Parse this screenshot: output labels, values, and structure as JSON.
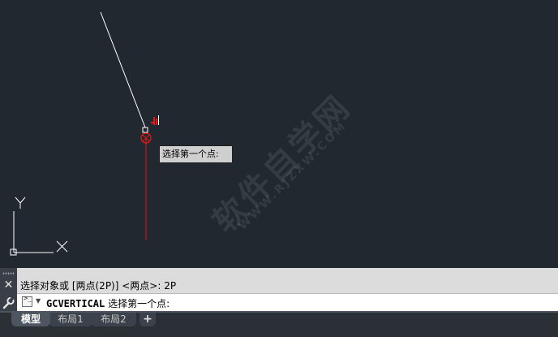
{
  "canvas": {
    "tooltip": "选择第一个点:",
    "watermark_text": "软件自学网",
    "watermark_url": "WWW.RJZXW.COM",
    "axis_labels": {
      "y": "Y",
      "x": "X"
    },
    "colors": {
      "background": "#212830",
      "drawn_line": "#ffffff",
      "rubber_band_line": "#e01818",
      "cursor_marker": "#e01818"
    }
  },
  "command": {
    "history_line": "选择对象或 [两点(2P)] <两点>: 2P",
    "prompt_icon": ">_",
    "command_name": "GCVERTICAL",
    "command_prompt": "选择第一个点:",
    "close_icon": "close-icon",
    "settings_icon": "wrench-icon"
  },
  "tabs": {
    "model": "模型",
    "layout1": "布局1",
    "layout2": "布局2",
    "add": "+"
  }
}
